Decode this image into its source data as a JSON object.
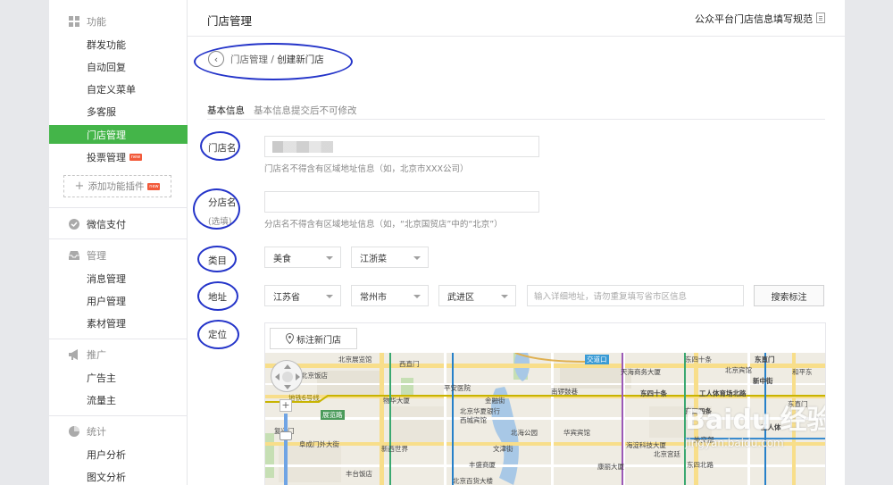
{
  "sidebar": {
    "sections": [
      {
        "label": "功能",
        "icon": "grid-icon"
      },
      {
        "label": "微信支付",
        "icon": "pay-icon"
      },
      {
        "label": "管理",
        "icon": "inbox-icon"
      },
      {
        "label": "推广",
        "icon": "megaphone-icon"
      },
      {
        "label": "统计",
        "icon": "pie-chart-icon"
      }
    ],
    "items": {
      "mass_send": "群发功能",
      "auto_reply": "自动回复",
      "custom_menu": "自定义菜单",
      "multi_service": "多客服",
      "store_manage": "门店管理",
      "vote_manage": "投票管理",
      "add_plugin": "添加功能插件",
      "message_manage": "消息管理",
      "user_manage": "用户管理",
      "material_manage": "素材管理",
      "advertiser": "广告主",
      "traffic_master": "流量主",
      "user_analysis": "用户分析",
      "article_analysis": "图文分析"
    },
    "new_badge": "new"
  },
  "header": {
    "title": "门店管理",
    "guide_link": "公众平台门店信息填写规范"
  },
  "breadcrumb": {
    "parent": "门店管理",
    "separator": "/",
    "current": "创建新门店"
  },
  "tabs": {
    "basic": "基本信息",
    "note": "基本信息提交后不可修改"
  },
  "form": {
    "store_name": {
      "label": "门店名",
      "value": "",
      "hint": "门店名不得含有区域地址信息（如，北京市XXX公司）"
    },
    "branch_name": {
      "label": "分店名",
      "sub": "(选填)",
      "value": "",
      "hint": "分店名不得含有区域地址信息（如，“北京国贸店”中的“北京”）"
    },
    "category": {
      "label": "类目",
      "primary": "美食",
      "secondary": "江浙菜"
    },
    "address": {
      "label": "地址",
      "province": "江苏省",
      "city": "常州市",
      "district": "武进区",
      "detail_placeholder": "输入详细地址，请勿重复填写省市区信息",
      "search_button": "搜索标注"
    },
    "location": {
      "label": "定位",
      "mark_button": "标注新门店"
    }
  },
  "map": {
    "labels": [
      "北京展览馆",
      "北京饭店",
      "西直门",
      "地铁6号线",
      "展览路",
      "物华大厦",
      "平安医院",
      "金融街",
      "北京华夏银行",
      "西城宾馆",
      "北海公园",
      "华宾宾馆",
      "复兴门",
      "阜成门外大街",
      "新西世界",
      "丰盛商厦",
      "丰台饭店",
      "文津街",
      "交道口",
      "天海商务大厦",
      "东四十条",
      "东四十条",
      "工人体育场北路",
      "南锣鼓巷",
      "康丽大厦",
      "海淀科技大厦",
      "东四北路",
      "东直门",
      "北京宾馆",
      "新中街",
      "东四四条",
      "北京百货大楼",
      "外交部",
      "北京宫廷",
      "和平东",
      "东直门",
      "工人体"
    ],
    "watermark": "Baidu 经验",
    "watermark_url": "jingyan.baidu.com",
    "zoom_in": "+"
  }
}
